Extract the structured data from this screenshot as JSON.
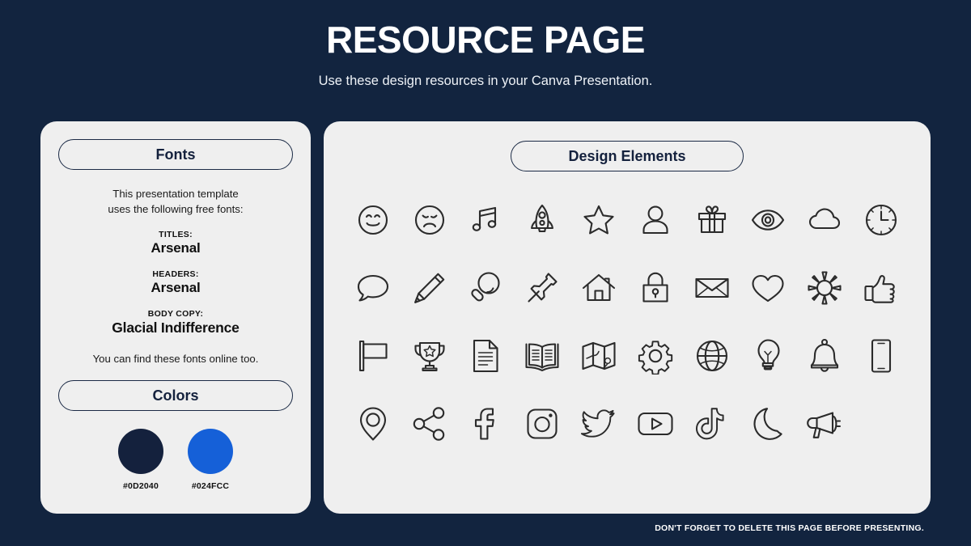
{
  "header": {
    "title": "RESOURCE PAGE",
    "subtitle": "Use these design resources in your Canva Presentation."
  },
  "fonts_panel": {
    "pill_label": "Fonts",
    "intro": "This presentation template\nuses the following free fonts:",
    "groups": [
      {
        "role": "TITLES:",
        "name": "Arsenal"
      },
      {
        "role": "HEADERS:",
        "name": "Arsenal"
      },
      {
        "role": "BODY COPY:",
        "name": "Glacial Indifference"
      }
    ],
    "outro": "You can find these fonts online too."
  },
  "colors_panel": {
    "pill_label": "Colors",
    "swatches": [
      {
        "hex_label": "#0D2040",
        "color": "#14213d"
      },
      {
        "hex_label": "#024FCC",
        "color": "#1560d8"
      }
    ]
  },
  "elements_panel": {
    "pill_label": "Design Elements",
    "icons": [
      "smiley-face-icon",
      "sad-face-icon",
      "music-note-icon",
      "rocket-icon",
      "star-icon",
      "person-icon",
      "gift-icon",
      "eye-icon",
      "cloud-icon",
      "clock-icon",
      "speech-bubble-icon",
      "pencil-icon",
      "magnifier-icon",
      "pushpin-icon",
      "house-icon",
      "lock-icon",
      "envelope-icon",
      "heart-icon",
      "sun-icon",
      "thumbs-up-icon",
      "flag-icon",
      "trophy-icon",
      "document-icon",
      "book-icon",
      "map-icon",
      "gear-icon",
      "globe-icon",
      "lightbulb-icon",
      "bell-icon",
      "phone-icon",
      "location-pin-icon",
      "share-icon",
      "facebook-icon",
      "instagram-icon",
      "twitter-icon",
      "youtube-icon",
      "tiktok-icon",
      "moon-icon",
      "megaphone-icon"
    ]
  },
  "footer": {
    "note": "DON'T FORGET TO DELETE THIS PAGE BEFORE PRESENTING."
  },
  "theme": {
    "background": "#12243f",
    "panel": "#efefef",
    "ink": "#14213d",
    "accent": "#1560d8"
  }
}
